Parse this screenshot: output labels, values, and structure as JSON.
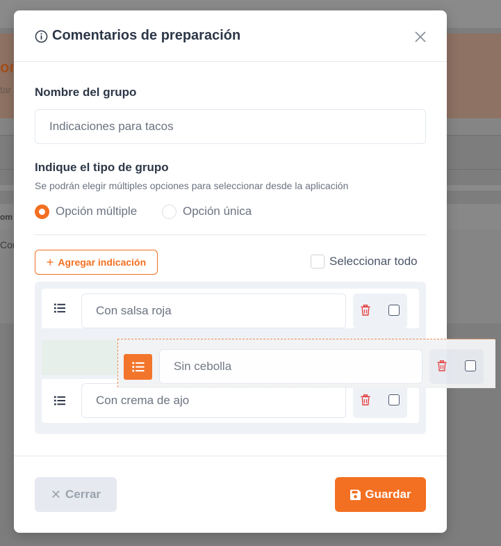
{
  "background": {
    "heading_fragment": "on",
    "sub_fragment": "tar",
    "table_header_fragment": "om",
    "table_cell_fragment": "Con"
  },
  "modal": {
    "title": "Comentarios de preparación",
    "title_icon": "info-icon",
    "close_icon": "close-icon"
  },
  "group_name": {
    "label": "Nombre del grupo",
    "value": "Indicaciones para tacos"
  },
  "group_type": {
    "label": "Indique el tipo de grupo",
    "hint": "Se podrán elegir múltiples opciones para seleccionar desde la aplicación",
    "options": [
      {
        "label": "Opción múltiple",
        "selected": true
      },
      {
        "label": "Opción única",
        "selected": false
      }
    ]
  },
  "toolbar": {
    "add_label": "Agregar indicación",
    "add_icon": "plus-icon",
    "select_all_label": "Seleccionar todo"
  },
  "items": [
    {
      "text": "Con salsa roja"
    },
    {
      "text": "Sin cebolla",
      "dragging": true
    },
    {
      "text": "Con crema de ajo"
    }
  ],
  "footer": {
    "close_label": "Cerrar",
    "close_icon": "x-icon",
    "save_label": "Guardar",
    "save_icon": "floppy-disk-icon"
  },
  "colors": {
    "accent": "#f36f21",
    "text": "#2d3748",
    "muted": "#6b7280",
    "danger": "#e53e3e"
  }
}
